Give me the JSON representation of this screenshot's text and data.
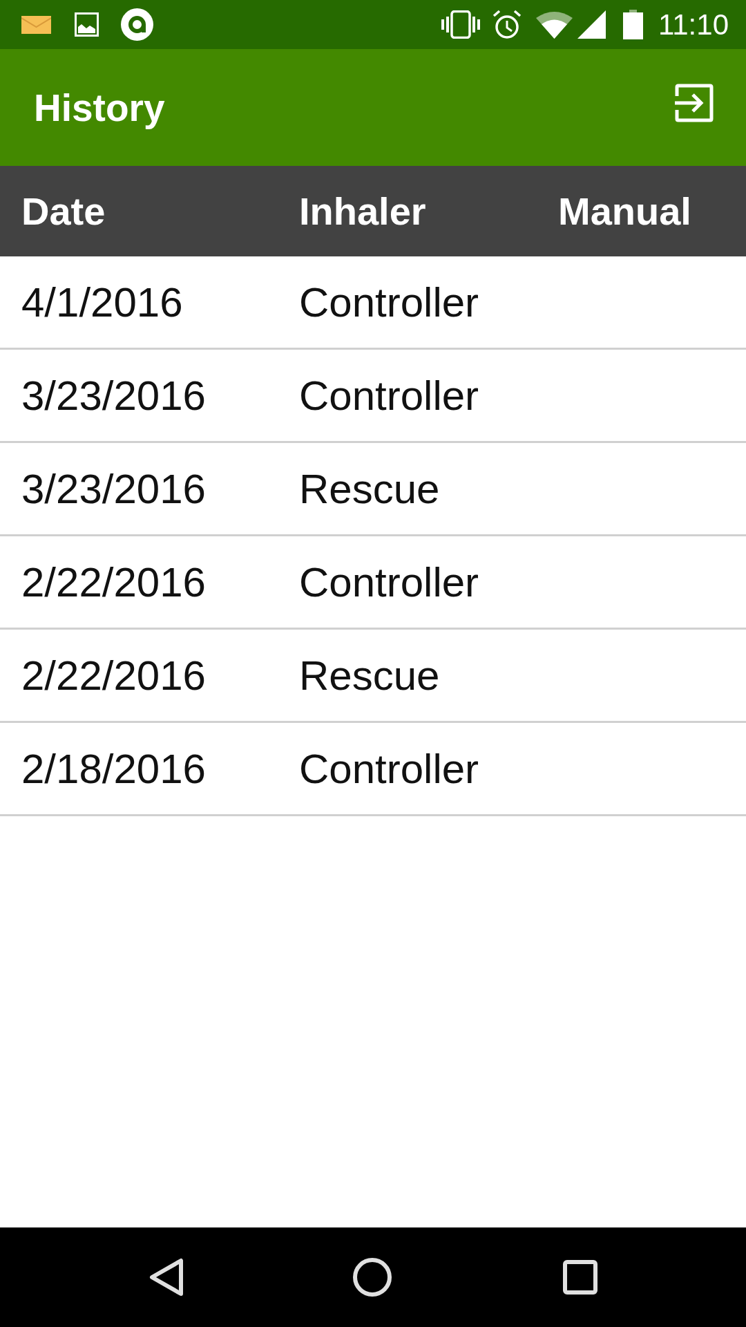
{
  "status_bar": {
    "time": "11:10"
  },
  "app_bar": {
    "title": "History"
  },
  "table": {
    "columns": [
      "Date",
      "Inhaler",
      "Manual"
    ],
    "rows": [
      [
        "4/1/2016",
        "Controller"
      ],
      [
        "3/23/2016",
        "Controller"
      ],
      [
        "3/23/2016",
        "Rescue"
      ],
      [
        "2/22/2016",
        "Controller"
      ],
      [
        "2/22/2016",
        "Rescue"
      ],
      [
        "2/18/2016",
        "Controller"
      ]
    ]
  }
}
